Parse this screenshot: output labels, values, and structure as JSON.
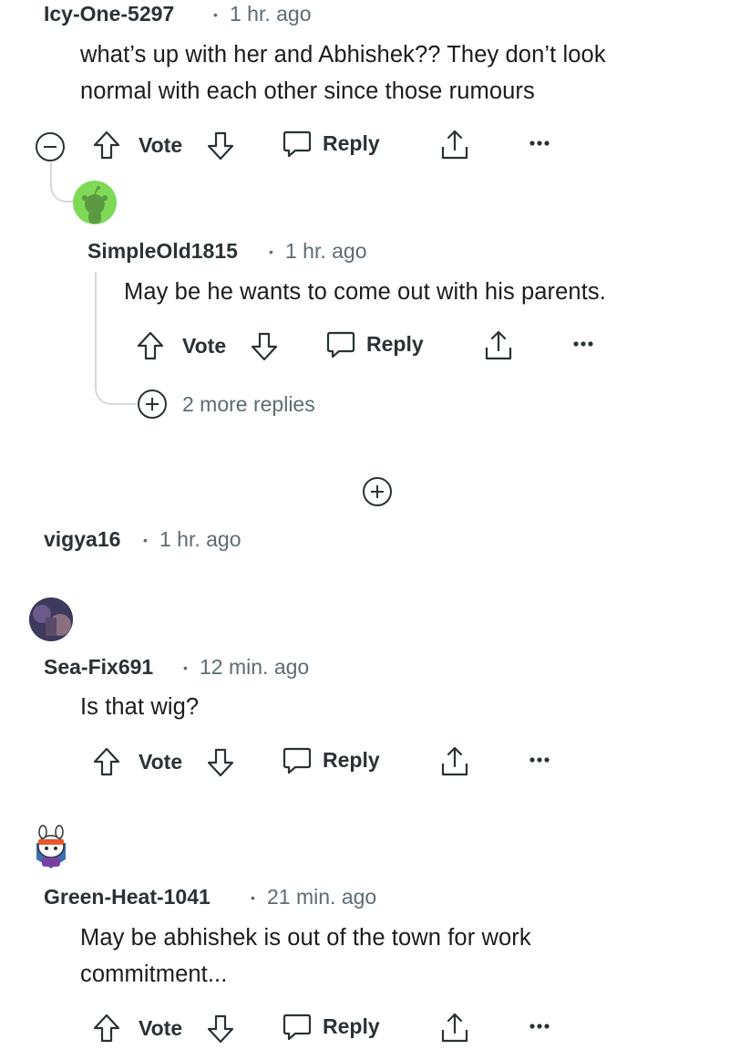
{
  "comments": [
    {
      "username": "Icy-One-5297",
      "time": "1 hr. ago",
      "lines": [
        "what’s up with her and Abhishek?? They don’t look",
        "normal with each other since those rumours"
      ],
      "actions": {
        "vote": "Vote",
        "reply": "Reply"
      }
    },
    {
      "username": "SimpleOld1815",
      "time": "1 hr. ago",
      "lines": [
        "May be he wants to come out with his parents."
      ],
      "actions": {
        "vote": "Vote",
        "reply": "Reply"
      },
      "more_replies": "2 more replies"
    },
    {
      "username": "vigya16",
      "time": "1 hr. ago"
    },
    {
      "username": "Sea-Fix691",
      "time": "12 min. ago",
      "lines": [
        "Is that wig?"
      ],
      "actions": {
        "vote": "Vote",
        "reply": "Reply"
      }
    },
    {
      "username": "Green-Heat-1041",
      "time": "21 min. ago",
      "lines": [
        "May be abhishek is out of the town for work",
        "commitment..."
      ],
      "actions": {
        "vote": "Vote",
        "reply": "Reply"
      }
    }
  ],
  "colors": {
    "avatar_green": "#7ed957",
    "text_primary": "#1c1c1c",
    "text_meta": "#5c6c74",
    "thread_line": "#d3d9dc"
  },
  "icons": [
    "collapse-icon",
    "upvote-icon",
    "downvote-icon",
    "reply-icon",
    "share-icon",
    "more-icon",
    "expand-icon"
  ]
}
